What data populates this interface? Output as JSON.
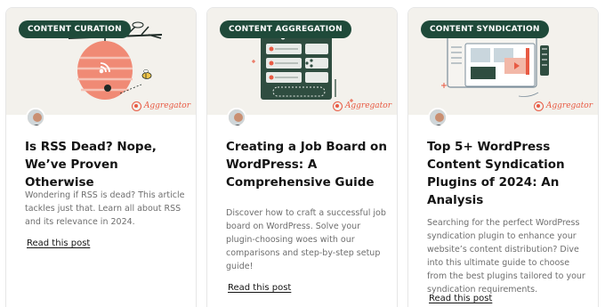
{
  "cards": [
    {
      "tag": "CONTENT CURATION",
      "title": "Is RSS Dead? Nope, We’ve Proven Otherwise",
      "excerpt": "Wondering if RSS is dead? This article tackles just that. Learn all about RSS and its relevance in 2024.",
      "link": "Read this post",
      "brand_small": "",
      "brand_name": "Aggregator"
    },
    {
      "tag": "CONTENT AGGREGATION",
      "title": "Creating a Job Board on WordPress: A Comprehensive Guide",
      "excerpt": "Discover how to craft a successful job board on WordPress. Solve your plugin-choosing woes with our comparisons and step-by-step setup guide!",
      "link": "Read this post",
      "brand_small": "",
      "brand_name": "Aggregator"
    },
    {
      "tag": "CONTENT SYNDICATION",
      "title": "Top 5+ WordPress Content Syndication Plugins of 2024: An Analysis",
      "excerpt": "Searching for the perfect WordPress syndication plugin to enhance your website’s content distribution? Dive into this ultimate guide to choose from the best plugins tailored to your syndication requirements.",
      "link": "Read this post",
      "brand_small": "",
      "brand_name": "Aggregator"
    }
  ],
  "colors": {
    "tag_bg": "#1f4a3a",
    "accent": "#e85a43",
    "thumb_bg": "#f3f1ec",
    "title": "#141414",
    "excerpt": "#6e6e6e"
  },
  "icons": [
    "rss-beehive-illustration",
    "bee-icon",
    "aggregation-dashboard-illustration",
    "syndication-window-illustration",
    "aggregator-logo-icon",
    "author-avatar"
  ]
}
